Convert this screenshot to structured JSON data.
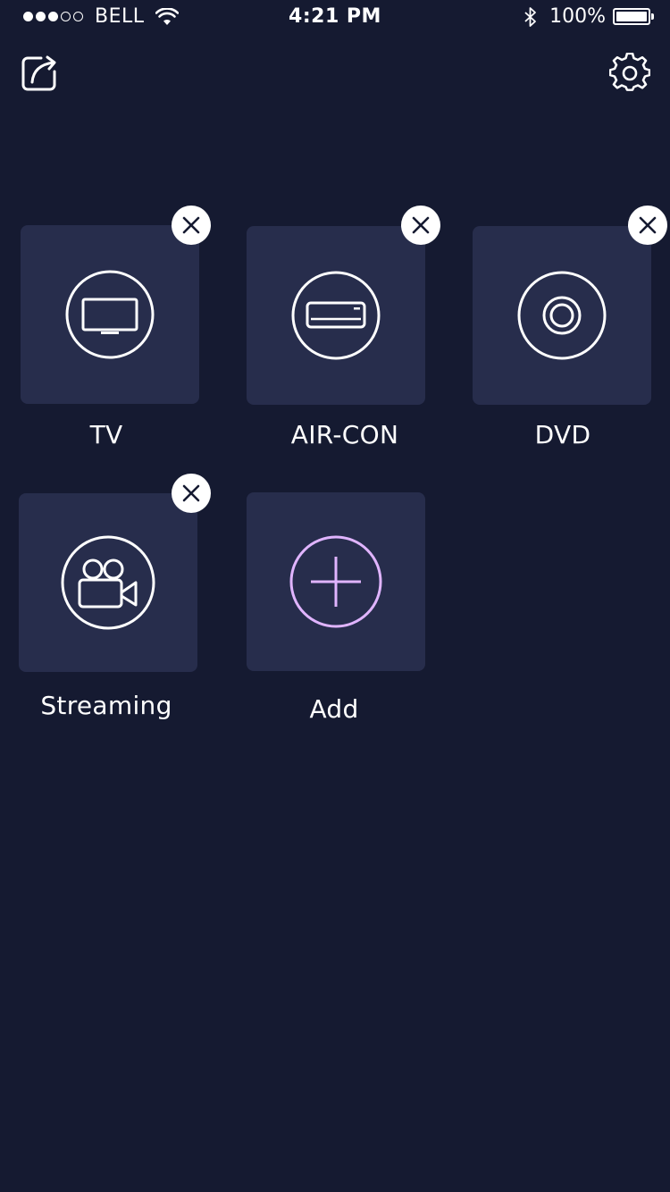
{
  "status_bar": {
    "carrier": "BELL",
    "time": "4:21 PM",
    "battery_percent": "100%",
    "signal_bars_filled": 3,
    "signal_bars_total": 5
  },
  "toolbar": {
    "share_icon": "share-icon",
    "settings_icon": "gear-icon"
  },
  "devices": [
    {
      "label": "TV",
      "icon": "tv-icon",
      "removable": true
    },
    {
      "label": "AIR-CON",
      "icon": "air-conditioner-icon",
      "removable": true
    },
    {
      "label": "DVD",
      "icon": "disc-icon",
      "removable": true
    },
    {
      "label": "Streaming",
      "icon": "video-camera-icon",
      "removable": true
    }
  ],
  "add_tile": {
    "label": "Add",
    "icon": "plus-icon"
  },
  "colors": {
    "background": "#151a31",
    "tile": "#272d4c",
    "text": "#ffffff",
    "add_accent": "#e0b4ff"
  }
}
